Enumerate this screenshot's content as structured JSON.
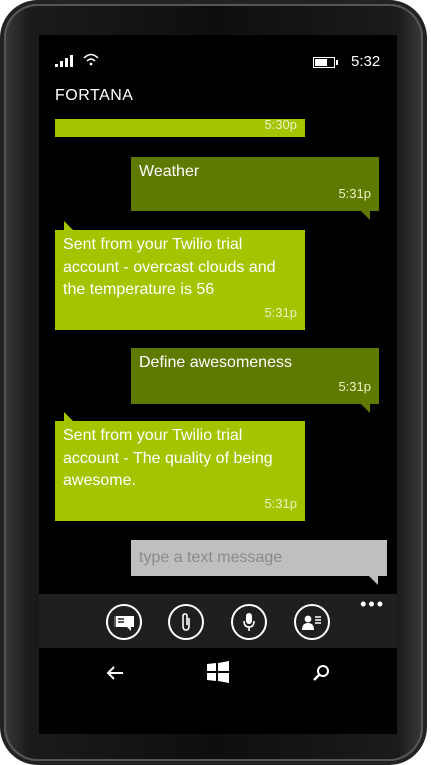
{
  "status": {
    "time": "5:32"
  },
  "app": {
    "title": "FORTANA"
  },
  "messages": [
    {
      "direction": "in",
      "text": "",
      "time": "5:30p"
    },
    {
      "direction": "out",
      "text": "Weather",
      "time": "5:31p"
    },
    {
      "direction": "in",
      "text": "Sent from your Twilio trial account - overcast clouds and the temperature is 56",
      "time": "5:31p"
    },
    {
      "direction": "out",
      "text": "Define awesomeness",
      "time": "5:31p"
    },
    {
      "direction": "in",
      "text": "Sent from your Twilio trial account - The quality of being awesome.",
      "time": "5:31p"
    }
  ],
  "compose": {
    "placeholder": "type a text message"
  },
  "appbar": {
    "more_label": "•••",
    "buttons": [
      {
        "icon": "message-switch-icon"
      },
      {
        "icon": "attach-icon"
      },
      {
        "icon": "microphone-icon"
      },
      {
        "icon": "contact-card-icon"
      }
    ]
  },
  "nav": {
    "back_icon": "back-arrow-icon",
    "start_icon": "windows-logo-icon",
    "search_icon": "search-icon"
  },
  "colors": {
    "incoming": "#a4c400",
    "outgoing": "#5f7a00",
    "compose_bg": "#bfbfbf"
  }
}
